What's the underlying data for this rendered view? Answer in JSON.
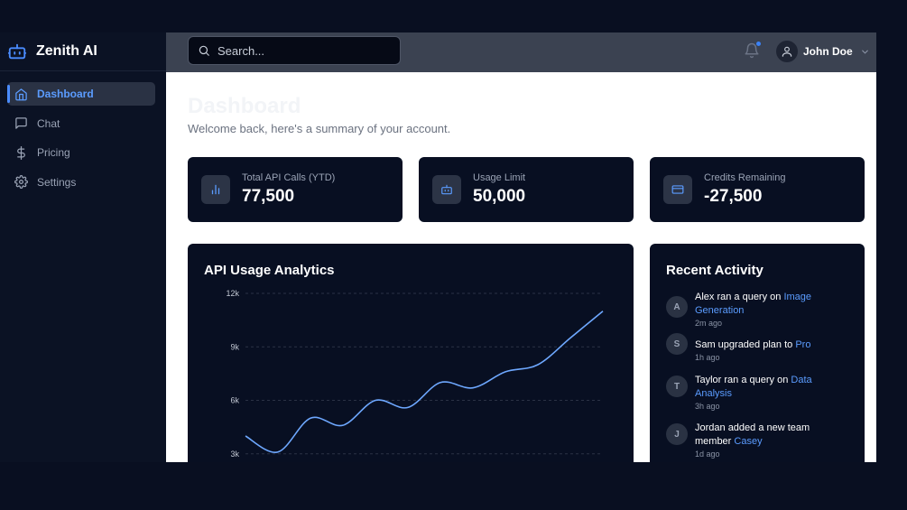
{
  "app": {
    "name": "Zenith AI"
  },
  "sidebar": {
    "items": [
      {
        "label": "Dashboard",
        "icon": "home-icon",
        "active": true
      },
      {
        "label": "Chat",
        "icon": "chat-icon",
        "active": false
      },
      {
        "label": "Pricing",
        "icon": "dollar-icon",
        "active": false
      },
      {
        "label": "Settings",
        "icon": "gear-icon",
        "active": false
      }
    ]
  },
  "header": {
    "search": {
      "placeholder": "Search..."
    },
    "notifications": {
      "icon": "bell-icon",
      "has_unread": true
    },
    "user": {
      "name": "John Doe"
    }
  },
  "main": {
    "title": "Dashboard",
    "subtitle": "Welcome back, here's a summary of your account.",
    "stats": [
      {
        "label": "Total API Calls (YTD)",
        "value": "77,500",
        "icon": "bar-chart-icon"
      },
      {
        "label": "Usage Limit",
        "value": "50,000",
        "icon": "robot-icon"
      },
      {
        "label": "Credits Remaining",
        "value": "-27,500",
        "icon": "credit-card-icon"
      }
    ],
    "analytics": {
      "title": "API Usage Analytics"
    },
    "activity": {
      "title": "Recent Activity",
      "items": [
        {
          "initial": "A",
          "text": "Alex ran a query on ",
          "link": "Image Generation",
          "time": "2m ago"
        },
        {
          "initial": "S",
          "text": "Sam upgraded plan to ",
          "link": "Pro",
          "time": "1h ago"
        },
        {
          "initial": "T",
          "text": "Taylor ran a query on ",
          "link": "Data Analysis",
          "time": "3h ago"
        },
        {
          "initial": "J",
          "text": "Jordan added a new team member ",
          "link": "Casey",
          "time": "1d ago"
        }
      ]
    }
  },
  "colors": {
    "accent": "#5b9cff",
    "sidebar_bg": "#0b1224",
    "card_bg": "#080f22",
    "header_bg": "#3b4251"
  },
  "chart_data": {
    "type": "line",
    "title": "API Usage Analytics",
    "y_ticks": [
      "12k",
      "9k",
      "6k",
      "3k"
    ],
    "ylim_visible": [
      3000,
      12000
    ],
    "grid": true,
    "series": [
      {
        "values": [
          4000,
          3100,
          5000,
          4600,
          6000,
          5600,
          7000,
          6700,
          7600,
          8000,
          9500,
          11000
        ]
      }
    ]
  }
}
